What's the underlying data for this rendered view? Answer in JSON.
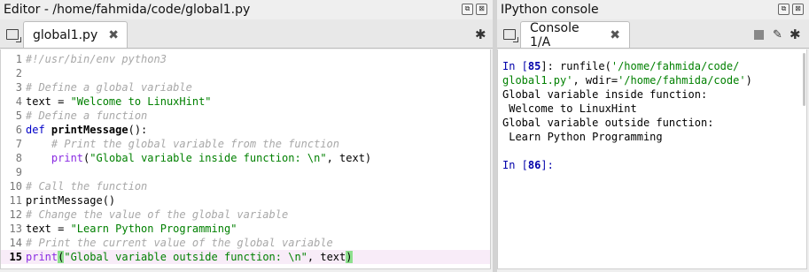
{
  "editor": {
    "title": "Editor - /home/fahmida/code/global1.py",
    "tab_label": "global1.py",
    "tab_close": "✖",
    "lines": [
      {
        "n": "1",
        "parts": [
          {
            "t": "#!/usr/bin/env python3",
            "c": "cm"
          }
        ]
      },
      {
        "n": "2",
        "parts": []
      },
      {
        "n": "3",
        "parts": [
          {
            "t": "# Define a global variable",
            "c": "cm"
          }
        ]
      },
      {
        "n": "4",
        "parts": [
          {
            "t": "text = ",
            "c": "plain"
          },
          {
            "t": "\"Welcome to LinuxHint\"",
            "c": "st"
          }
        ]
      },
      {
        "n": "5",
        "parts": [
          {
            "t": "# Define a function",
            "c": "cm"
          }
        ]
      },
      {
        "n": "6",
        "parts": [
          {
            "t": "def ",
            "c": "kw"
          },
          {
            "t": "printMessage",
            "c": "fn"
          },
          {
            "t": "():",
            "c": "plain"
          }
        ]
      },
      {
        "n": "7",
        "parts": [
          {
            "t": "    # Print the global variable from the function",
            "c": "cm"
          }
        ]
      },
      {
        "n": "8",
        "parts": [
          {
            "t": "    ",
            "c": "plain"
          },
          {
            "t": "print",
            "c": "bi"
          },
          {
            "t": "(",
            "c": "plain"
          },
          {
            "t": "\"Global variable inside function: \\n\"",
            "c": "st"
          },
          {
            "t": ", text)",
            "c": "plain"
          }
        ]
      },
      {
        "n": "9",
        "parts": []
      },
      {
        "n": "10",
        "parts": [
          {
            "t": "# Call the function",
            "c": "cm"
          }
        ]
      },
      {
        "n": "11",
        "parts": [
          {
            "t": "printMessage()",
            "c": "plain"
          }
        ]
      },
      {
        "n": "12",
        "parts": [
          {
            "t": "# Change the value of the global variable",
            "c": "cm"
          }
        ]
      },
      {
        "n": "13",
        "parts": [
          {
            "t": "text = ",
            "c": "plain"
          },
          {
            "t": "\"Learn Python Programming\"",
            "c": "st"
          }
        ]
      },
      {
        "n": "14",
        "parts": [
          {
            "t": "# Print the current value of the global variable",
            "c": "cm"
          }
        ]
      },
      {
        "n": "15",
        "current": true,
        "parts": [
          {
            "t": "print",
            "c": "bi"
          },
          {
            "t": "(",
            "c": "paren-hl"
          },
          {
            "t": "\"Global variable outside function: \\n\"",
            "c": "st"
          },
          {
            "t": ", text",
            "c": "plain"
          },
          {
            "t": ")",
            "c": "paren-hl"
          }
        ]
      }
    ]
  },
  "console": {
    "title": "IPython console",
    "tab_label": "Console 1/A",
    "tab_close": "✖",
    "lines": [
      [
        {
          "t": "In [",
          "c": "prompt"
        },
        {
          "t": "85",
          "c": "prompt-b"
        },
        {
          "t": "]: runfile(",
          "c": "plain"
        },
        {
          "t": "'/home/fahmida/code/",
          "c": "path"
        }
      ],
      [
        {
          "t": "global1.py'",
          "c": "path"
        },
        {
          "t": ", wdir=",
          "c": "plain"
        },
        {
          "t": "'/home/fahmida/code'",
          "c": "path"
        },
        {
          "t": ")",
          "c": "plain"
        }
      ],
      [
        {
          "t": "Global variable inside function:",
          "c": "plain"
        }
      ],
      [
        {
          "t": " Welcome to LinuxHint",
          "c": "plain"
        }
      ],
      [
        {
          "t": "Global variable outside function:",
          "c": "plain"
        }
      ],
      [
        {
          "t": " Learn Python Programming",
          "c": "plain"
        }
      ],
      [],
      [
        {
          "t": "In [",
          "c": "prompt"
        },
        {
          "t": "86",
          "c": "prompt-b"
        },
        {
          "t": "]:",
          "c": "prompt"
        }
      ]
    ]
  },
  "icons": {
    "undock": "⧉",
    "close_pane": "⊠",
    "gear": "✱",
    "stop": "■",
    "eraser": "✎"
  }
}
